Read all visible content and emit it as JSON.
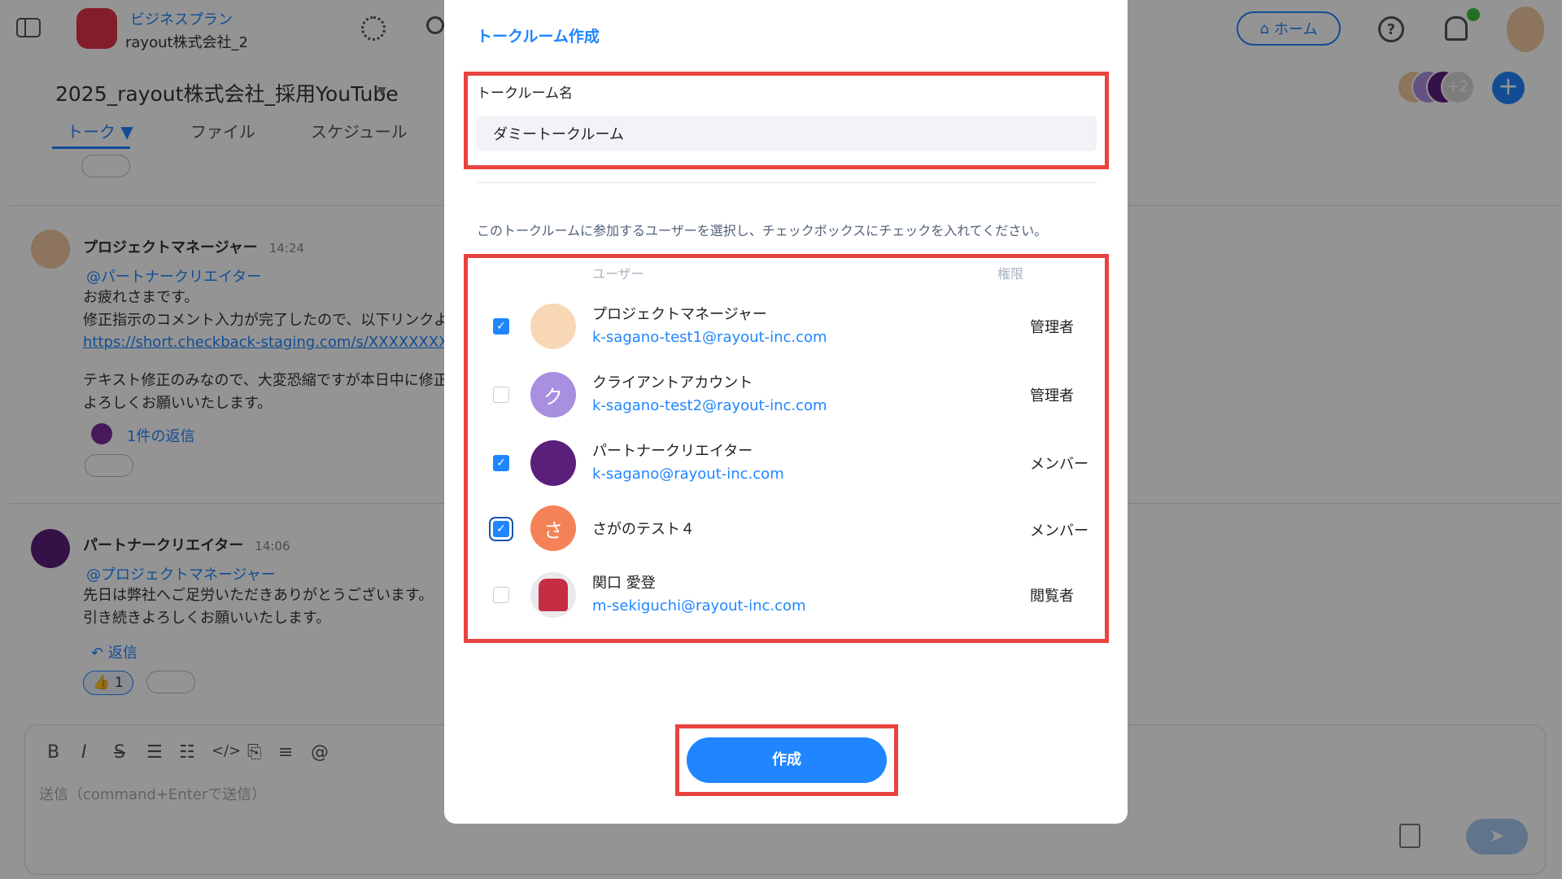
{
  "header": {
    "plan_label": "ビジネスプラン",
    "company_name": "rayout株式会社_2",
    "home_label": "ホーム",
    "help_symbol": "?"
  },
  "room": {
    "title": "2025_rayout株式会社_採用YouTube",
    "caret": "▼",
    "tabs": [
      "トーク ▼",
      "ファイル",
      "スケジュール"
    ],
    "member_more": "+2",
    "add_symbol": "+"
  },
  "messages": [
    {
      "author": "プロジェクトマネージャー",
      "time": "14:24",
      "mention": "@パートナークリエイター",
      "lines": [
        "お疲れさまです。",
        "修正指示のコメント入力が完了したので、以下リンクよ"
      ],
      "link": "https://short.checkback-staging.com/s/XXXXXXXXXX",
      "lines2": [
        "テキスト修正のみなので、大変恐縮ですが本日中に修正",
        "よろしくお願いいたします。"
      ],
      "reply_count": "1件の返信"
    },
    {
      "author": "パートナークリエイター",
      "time": "14:06",
      "mention": "@プロジェクトマネージャー",
      "lines": [
        "先日は弊社へご足労いただきありがとうございます。",
        "引き続きよろしくお願いいたします。"
      ],
      "reply_label": "返信",
      "like": "👍 1"
    }
  ],
  "composer": {
    "placeholder": "送信（command+Enterで送信）",
    "tools": [
      "B",
      "I",
      "S",
      "☰",
      "☷",
      "</>",
      "⎘",
      "≡",
      "@"
    ]
  },
  "dialog": {
    "title": "トークルーム作成",
    "name_label": "トークルーム名",
    "name_value": "ダミートークルーム",
    "instruction": "このトークルームに参加するユーザーを選択し、チェックボックスにチェックを入れてください。",
    "col_user": "ユーザー",
    "col_perm": "権限",
    "users": [
      {
        "name": "プロジェクトマネージャー",
        "email": "k-sagano-test1@rayout-inc.com",
        "perm": "管理者",
        "checked": true,
        "avatar_color": "#f7d7b6",
        "initial": ""
      },
      {
        "name": "クライアントアカウント",
        "email": "k-sagano-test2@rayout-inc.com",
        "perm": "管理者",
        "checked": false,
        "avatar_color": "#a98fe0",
        "initial": "ク"
      },
      {
        "name": "パートナークリエイター",
        "email": "k-sagano@rayout-inc.com",
        "perm": "メンバー",
        "checked": true,
        "avatar_color": "#5a1f7a",
        "initial": ""
      },
      {
        "name": "さがのテスト４",
        "email": "",
        "perm": "メンバー",
        "checked": true,
        "avatar_color": "#f58256",
        "initial": "さ"
      },
      {
        "name": "関口 愛登",
        "email": "m-sekiguchi@rayout-inc.com",
        "perm": "閲覧者",
        "checked": false,
        "avatar_color": "#c72c45",
        "initial": ""
      }
    ],
    "create_label": "作成"
  }
}
